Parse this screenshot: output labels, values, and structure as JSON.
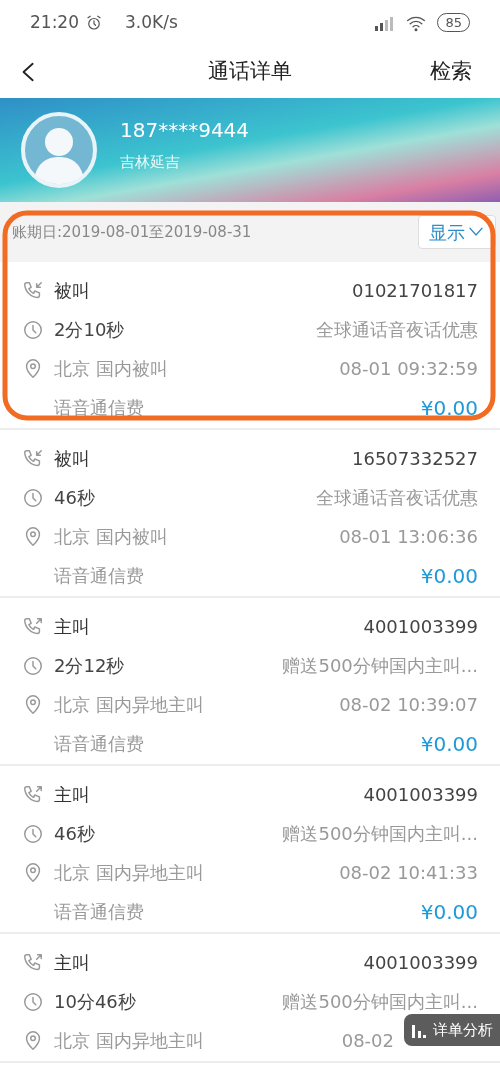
{
  "status_bar": {
    "time": "21:20",
    "speed": "3.0K/s",
    "battery": "85"
  },
  "nav": {
    "title": "通话详单",
    "action": "检索"
  },
  "profile": {
    "number": "187****9444",
    "region": "吉林延吉"
  },
  "bill_period": {
    "label": "账期日:2019-08-01至2019-08-31",
    "toggle": "显示"
  },
  "annotation": {
    "kind": "ring"
  },
  "records": [
    {
      "kind": "incoming",
      "type": "被叫",
      "number": "01021701817",
      "duration": "2分10秒",
      "plan": "全球通话音夜话优惠",
      "place": "北京 国内被叫",
      "time": "08-01 09:32:59",
      "fee_label": "语音通信费",
      "fee": "¥0.00"
    },
    {
      "kind": "incoming",
      "type": "被叫",
      "number": "16507332527",
      "duration": "46秒",
      "plan": "全球通话音夜话优惠",
      "place": "北京 国内被叫",
      "time": "08-01 13:06:36",
      "fee_label": "语音通信费",
      "fee": "¥0.00"
    },
    {
      "kind": "outgoing",
      "type": "主叫",
      "number": "4001003399",
      "duration": "2分12秒",
      "plan": "赠送500分钟国内主叫...",
      "place": "北京 国内异地主叫",
      "time": "08-02 10:39:07",
      "fee_label": "语音通信费",
      "fee": "¥0.00"
    },
    {
      "kind": "outgoing",
      "type": "主叫",
      "number": "4001003399",
      "duration": "46秒",
      "plan": "赠送500分钟国内主叫...",
      "place": "北京 国内异地主叫",
      "time": "08-02 10:41:33",
      "fee_label": "语音通信费",
      "fee": "¥0.00"
    },
    {
      "kind": "outgoing",
      "type": "主叫",
      "number": "4001003399",
      "duration": "10分46秒",
      "plan": "赠送500分钟国内主叫...",
      "place": "北京 国内异地主叫",
      "time": "08-02"
    }
  ],
  "floating_button": {
    "label": "详单分析"
  }
}
